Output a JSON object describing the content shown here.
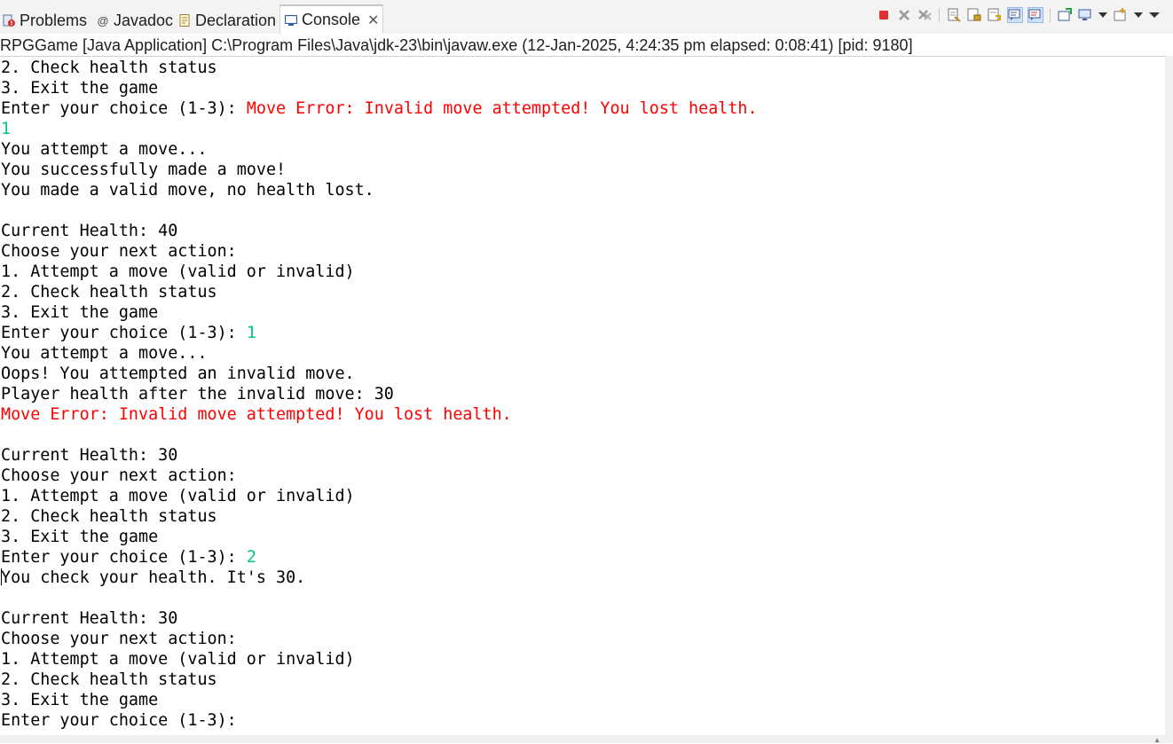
{
  "tabs": [
    {
      "label": "Problems",
      "icon": "problems-icon"
    },
    {
      "label": "Javadoc",
      "icon": "javadoc-icon"
    },
    {
      "label": "Declaration",
      "icon": "declaration-icon"
    },
    {
      "label": "Console",
      "icon": "console-icon",
      "active": true
    }
  ],
  "process_info": "RPGGame [Java Application] C:\\Program Files\\Java\\jdk-23\\bin\\javaw.exe  (12-Jan-2025, 4:24:35 pm elapsed: 0:08:41) [pid: 9180]",
  "colors": {
    "error": "#ff0000",
    "input": "#00c87d",
    "stop": "#e03030"
  },
  "console_lines": [
    {
      "t": "2. Check health status"
    },
    {
      "t": "3. Exit the game"
    },
    {
      "t": "Enter your choice (1-3): ",
      "err": "Move Error: Invalid move attempted! You lost health."
    },
    {
      "inp": "1"
    },
    {
      "t": "You attempt a move..."
    },
    {
      "t": "You successfully made a move!"
    },
    {
      "t": "You made a valid move, no health lost."
    },
    {
      "t": ""
    },
    {
      "t": "Current Health: 40"
    },
    {
      "t": "Choose your next action:"
    },
    {
      "t": "1. Attempt a move (valid or invalid)"
    },
    {
      "t": "2. Check health status"
    },
    {
      "t": "3. Exit the game"
    },
    {
      "t": "Enter your choice (1-3): ",
      "inp": "1"
    },
    {
      "t": "You attempt a move..."
    },
    {
      "t": "Oops! You attempted an invalid move."
    },
    {
      "t": "Player health after the invalid move: 30"
    },
    {
      "err": "Move Error: Invalid move attempted! You lost health."
    },
    {
      "t": ""
    },
    {
      "t": "Current Health: 30"
    },
    {
      "t": "Choose your next action:"
    },
    {
      "t": "1. Attempt a move (valid or invalid)"
    },
    {
      "t": "2. Check health status"
    },
    {
      "t": "3. Exit the game"
    },
    {
      "t": "Enter your choice (1-3): ",
      "inp": "2"
    },
    {
      "t": "You check your health. It's 30.",
      "caret": true
    },
    {
      "t": ""
    },
    {
      "t": "Current Health: 30"
    },
    {
      "t": "Choose your next action:"
    },
    {
      "t": "1. Attempt a move (valid or invalid)"
    },
    {
      "t": "2. Check health status"
    },
    {
      "t": "3. Exit the game"
    },
    {
      "t": "Enter your choice (1-3): "
    }
  ]
}
